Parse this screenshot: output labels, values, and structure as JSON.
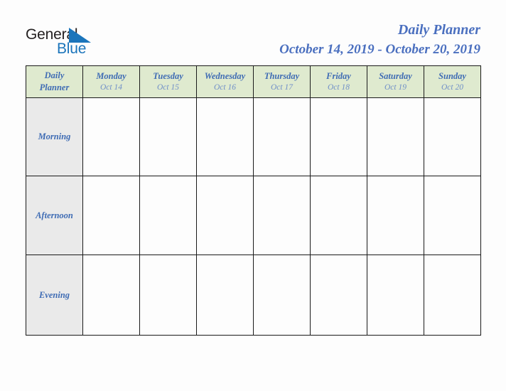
{
  "brand": {
    "name_dark": "General",
    "name_blue": "Blue",
    "flag_icon": "blue-triangle-flag-icon",
    "colors": {
      "dark": "#231f20",
      "blue": "#1b75bb"
    }
  },
  "header": {
    "title": "Daily Planner",
    "date_range": "October 14, 2019 - October 20, 2019",
    "title_color": "#4a6fbf"
  },
  "table": {
    "corner": {
      "line1": "Daily",
      "line2": "Planner"
    },
    "header_bg": "#dfeacf",
    "label_bg": "#eaeaea",
    "border_color": "#1a1a1a",
    "day_columns": [
      {
        "day": "Monday",
        "date": "Oct 14"
      },
      {
        "day": "Tuesday",
        "date": "Oct 15"
      },
      {
        "day": "Wednesday",
        "date": "Oct 16"
      },
      {
        "day": "Thursday",
        "date": "Oct 17"
      },
      {
        "day": "Friday",
        "date": "Oct 18"
      },
      {
        "day": "Saturday",
        "date": "Oct 19"
      },
      {
        "day": "Sunday",
        "date": "Oct 20"
      }
    ],
    "rows": [
      {
        "label": "Morning",
        "cells": [
          "",
          "",
          "",
          "",
          "",
          "",
          ""
        ]
      },
      {
        "label": "Afternoon",
        "cells": [
          "",
          "",
          "",
          "",
          "",
          "",
          ""
        ]
      },
      {
        "label": "Evening",
        "cells": [
          "",
          "",
          "",
          "",
          "",
          "",
          ""
        ]
      }
    ]
  }
}
